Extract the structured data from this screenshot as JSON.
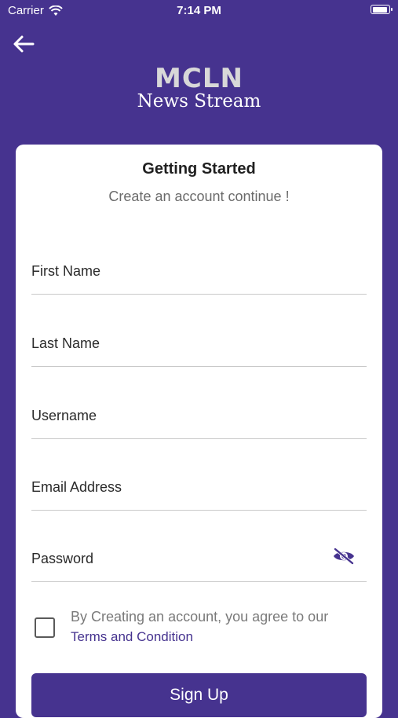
{
  "status_bar": {
    "carrier": "Carrier",
    "time": "7:14 PM",
    "battery_level": 0.95
  },
  "header": {
    "back_icon": "arrow-left-icon",
    "logo_main": "MCLN",
    "logo_sub": "News Stream"
  },
  "card": {
    "title": "Getting Started",
    "subtitle": "Create an account continue !",
    "fields": {
      "first_name": {
        "placeholder": "First Name",
        "value": ""
      },
      "last_name": {
        "placeholder": "Last Name",
        "value": ""
      },
      "username": {
        "placeholder": "Username",
        "value": ""
      },
      "email": {
        "placeholder": "Email Address",
        "value": ""
      },
      "password": {
        "placeholder": "Password",
        "value": "",
        "toggle_icon": "eye-off-icon"
      }
    },
    "agreement": {
      "checked": false,
      "text": "By Creating an account, you agree to our",
      "link": "Terms and Condition"
    },
    "signup_label": "Sign Up"
  },
  "colors": {
    "primary": "#46338f",
    "card": "#ffffff",
    "logo_main": "#d8d8d8",
    "link": "#46338f"
  }
}
